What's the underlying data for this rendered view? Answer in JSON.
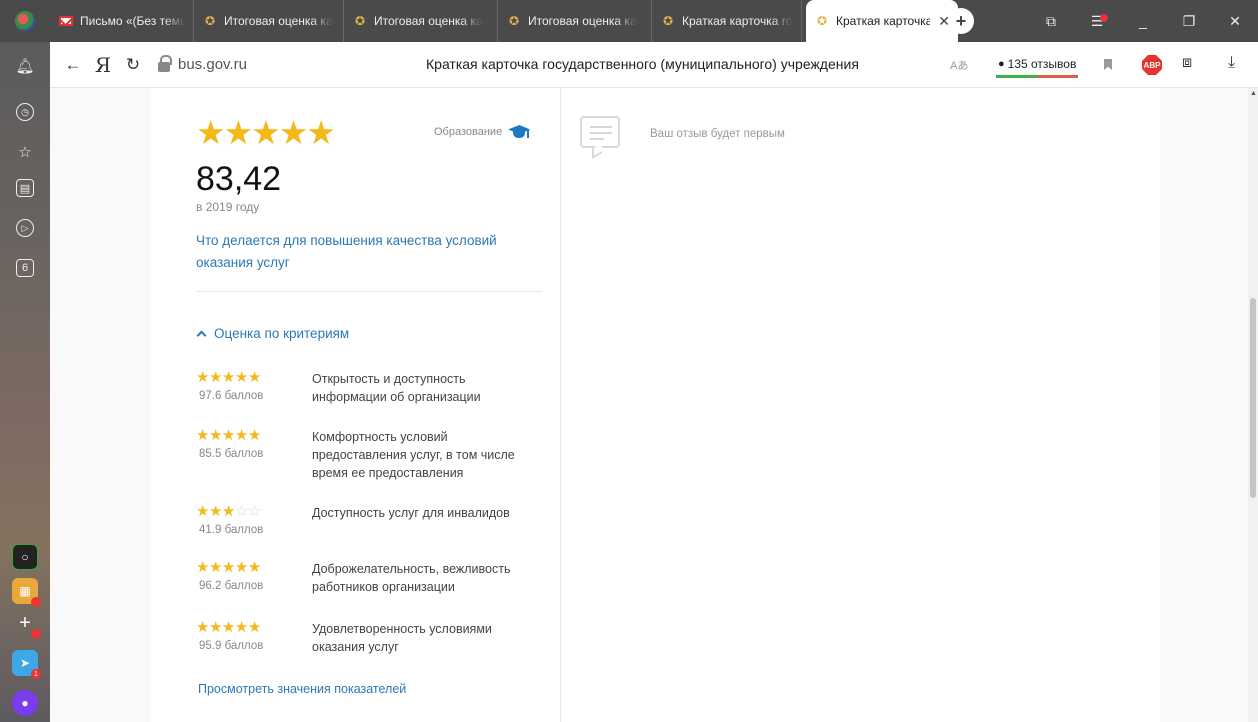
{
  "browser": {
    "tabs": [
      {
        "label": "Письмо «(Без темы)»",
        "icon": "gmail-icon",
        "active": false
      },
      {
        "label": "Итоговая оценка ка",
        "icon": "emblem-icon",
        "active": false
      },
      {
        "label": "Итоговая оценка ка",
        "icon": "emblem-icon",
        "active": false
      },
      {
        "label": "Итоговая оценка ка",
        "icon": "emblem-icon",
        "active": false
      },
      {
        "label": "Краткая карточка го",
        "icon": "emblem-icon",
        "active": false
      },
      {
        "label": "Краткая карточка",
        "icon": "emblem-icon",
        "active": true
      }
    ],
    "address": {
      "domain": "bus.gov.ru",
      "page_title": "Краткая карточка государственного (муниципального) учреждения",
      "reviews": "135 отзывов"
    },
    "sidebar": {
      "tab_count": "6"
    }
  },
  "rating": {
    "category": "Образование",
    "score": "83,42",
    "year": "в 2019 году",
    "improve_link": "Что делается для повышения качества условий оказания услуг",
    "criteria_toggle": "Оценка по критериям",
    "criteria": [
      {
        "stars": 5,
        "points": "97.6 баллов",
        "label": "Открытость и доступность информации об организации"
      },
      {
        "stars": 5,
        "points": "85.5 баллов",
        "label": "Комфортность условий предоставления услуг, в том числе время ее предоставления"
      },
      {
        "stars": 3,
        "points": "41.9 баллов",
        "label": "Доступность услуг для инвалидов"
      },
      {
        "stars": 5,
        "points": "96.2 баллов",
        "label": "Доброжелательность, вежливость работников организации"
      },
      {
        "stars": 5,
        "points": "95.9 баллов",
        "label": "Удовлетворенность условиями оказания услуг"
      }
    ],
    "indicators_link": "Просмотреть значения показателей"
  },
  "reviews_panel": {
    "empty_text": "Ваш отзыв будет первым"
  },
  "colors": {
    "star": "#f2b918",
    "star_empty": "#d7d7d7",
    "link": "#2a79b8",
    "tabbar": "#4a4a4a"
  }
}
